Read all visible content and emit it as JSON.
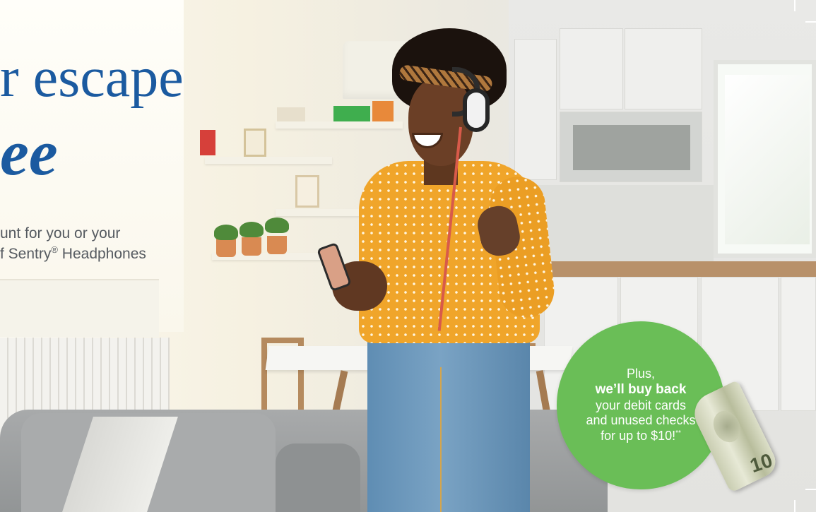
{
  "headline": {
    "line1": "r escape",
    "line2": "ee"
  },
  "subtext": {
    "line1": "unt for you or your",
    "line2_prefix": "f Sentry",
    "line2_reg": "®",
    "line2_suffix": " Headphones"
  },
  "promo": {
    "line1": "Plus,",
    "line2": "we’ll buy back",
    "line3": "your debit cards",
    "line4": "and unused checks",
    "line5": "for up to $10!",
    "line5_mark": "**"
  },
  "bill": {
    "denomination": "10"
  },
  "colors": {
    "headline": "#1b5aa0",
    "promo_circle": "#6abe57",
    "subtext": "#555a60",
    "shirt": "#f0a52a",
    "jeans": "#6d97bb"
  },
  "icons": {
    "bill": "dollar-bill-icon",
    "headphones": "headphones-icon"
  }
}
